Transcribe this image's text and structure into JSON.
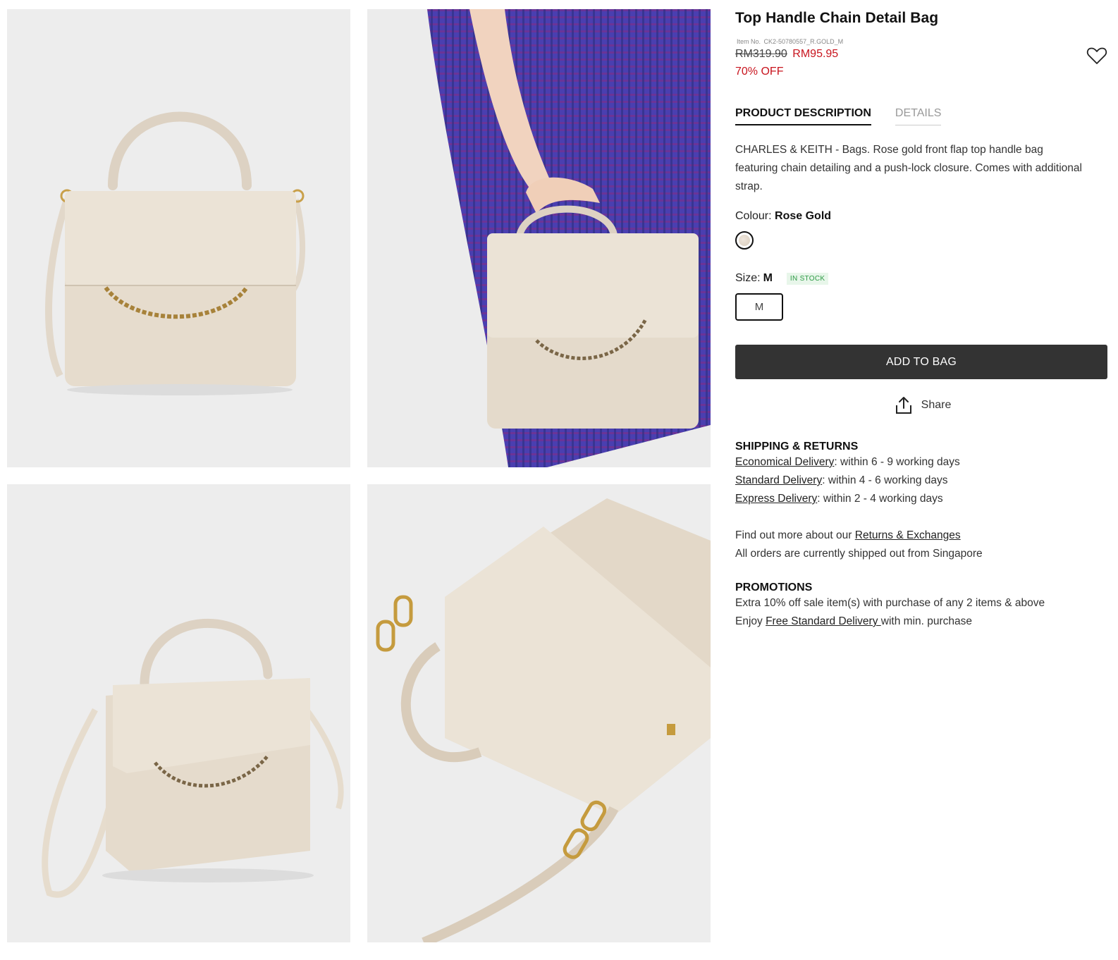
{
  "product": {
    "title": "Top Handle Chain Detail Bag",
    "item_no_label": "Item No.",
    "item_no": "CK2-50780557_R.GOLD_M",
    "old_price": "RM319.90",
    "new_price": "RM95.95",
    "discount": "70% OFF"
  },
  "tabs": [
    "PRODUCT DESCRIPTION",
    "DETAILS"
  ],
  "description": "CHARLES & KEITH - Bags. Rose gold front flap top handle bag featuring chain detailing and a push-lock closure. Comes with additional strap.",
  "colour": {
    "label": "Colour:",
    "value": "Rose Gold"
  },
  "size": {
    "label": "Size:",
    "value": "M",
    "stock": "IN STOCK",
    "option": "M"
  },
  "actions": {
    "add_to_bag": "ADD TO BAG",
    "share": "Share"
  },
  "shipping": {
    "heading": "SHIPPING & RETURNS",
    "options": [
      {
        "link": "Economical Delivery",
        "text": ": within 6 - 9 working days"
      },
      {
        "link": "Standard Delivery",
        "text": ": within 4 - 6 working days"
      },
      {
        "link": "Express Delivery",
        "text": ": within 2 - 4 working days"
      }
    ],
    "returns_prefix": "Find out more about our ",
    "returns_link": "Returns & Exchanges",
    "shipped_from": "All orders are currently shipped out from Singapore"
  },
  "promotions": {
    "heading": "PROMOTIONS",
    "line1": "Extra 10% off sale item(s) with purchase of any 2 items & above",
    "line2_prefix": "Enjoy ",
    "line2_link": "Free Standard Delivery ",
    "line2_suffix": "with min. purchase"
  },
  "colors": {
    "sale_red": "#c8141e",
    "button_dark": "#333333",
    "stock_green": "#2e9b46",
    "photo_bg": "#ededed",
    "bag_rose_gold": "#e3d8c8"
  }
}
